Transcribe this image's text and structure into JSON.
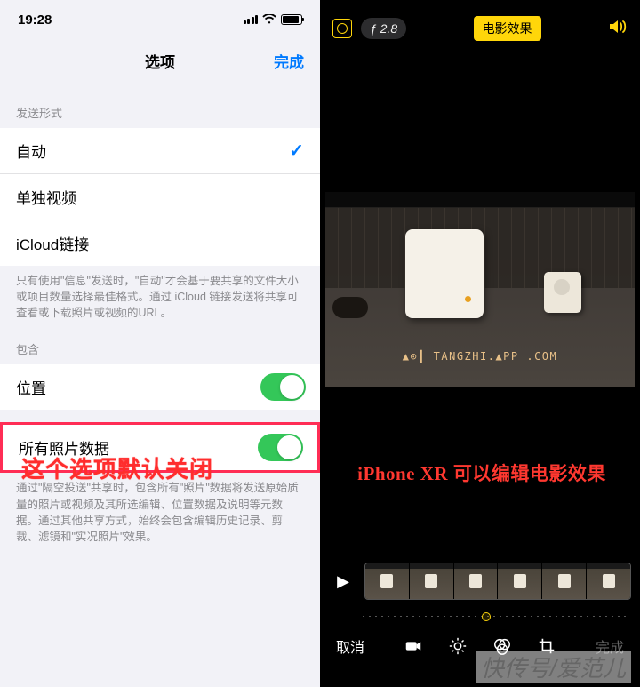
{
  "left": {
    "status_time": "19:28",
    "modal_title": "选项",
    "modal_done": "完成",
    "section_send_label": "发送形式",
    "send_options": [
      "自动",
      "单独视频",
      "iCloud链接"
    ],
    "send_footer": "只有使用\"信息\"发送时，\"自动\"才会基于要共享的文件大小或项目数量选择最佳格式。通过 iCloud 链接发送将共享可查看或下载照片或视频的URL。",
    "section_include_label": "包含",
    "location_label": "位置",
    "all_photo_data_label": "所有照片数据",
    "all_photo_footer": "通过\"隔空投送\"共享时，包含所有\"照片\"数据将发送原始质量的照片或视频及其所选编辑、位置数据及说明等元数据。通过其他共享方式，始终会包含编辑历史记录、剪裁、滤镜和\"实况照片\"效果。",
    "annotation": "这个选项默认关闭"
  },
  "right": {
    "f_stop": "ƒ 2.8",
    "cinema_label": "电影效果",
    "desk_text": "▲⊙┃ TANGZHI.▲PP .COM",
    "annotation_prefix": "iPhone XR ",
    "annotation_suffix": "可以编辑电影效果",
    "cancel_label": "取消",
    "done_label": "完成"
  },
  "watermark": "快传号/爱范儿"
}
